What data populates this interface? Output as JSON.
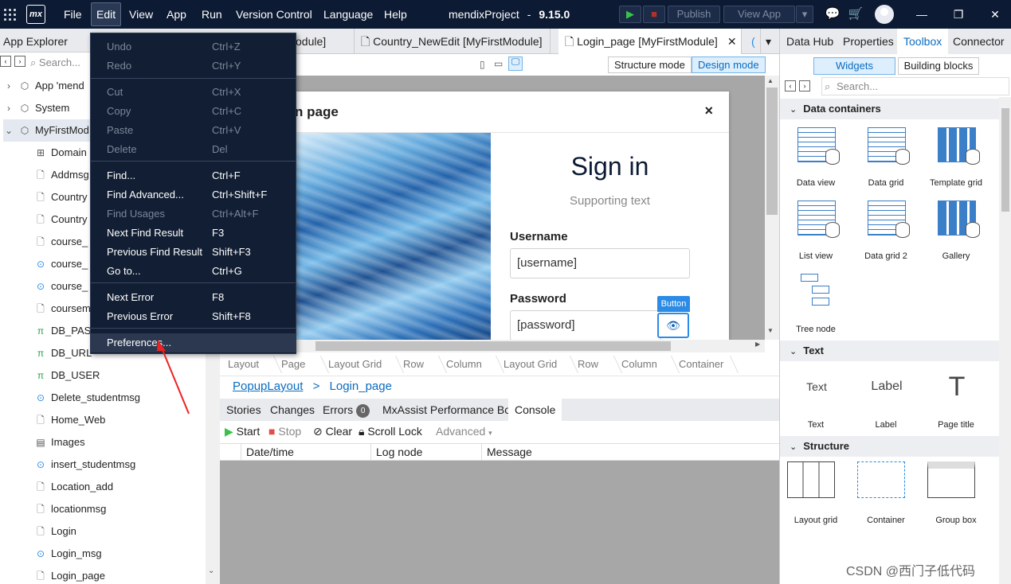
{
  "titlebar": {
    "logo": "mx",
    "menus": [
      "File",
      "Edit",
      "View",
      "App",
      "Run",
      "Version Control",
      "Language",
      "Help"
    ],
    "project": "mendixProject",
    "separator": "-",
    "version": "9.15.0",
    "publish": "Publish",
    "view_app": "View App"
  },
  "app_explorer": {
    "title": "App Explorer",
    "search_placeholder": "Search...",
    "items": [
      {
        "label": "App 'mend",
        "icon": "cube-icon"
      },
      {
        "label": "System",
        "icon": "cube-icon"
      },
      {
        "label": "MyFirstMod",
        "icon": "cube-icon"
      },
      {
        "label": "Domain",
        "icon": "domain-model-icon"
      },
      {
        "label": "Addmsg",
        "icon": "page-icon"
      },
      {
        "label": "Country",
        "icon": "page-icon"
      },
      {
        "label": "Country",
        "icon": "page-icon"
      },
      {
        "label": "course_",
        "icon": "page-icon"
      },
      {
        "label": "course_",
        "icon": "microflow-icon"
      },
      {
        "label": "course_",
        "icon": "microflow-icon"
      },
      {
        "label": "coursem",
        "icon": "page-icon"
      },
      {
        "label": "DB_PAS",
        "icon": "constant-icon"
      },
      {
        "label": "DB_URL",
        "icon": "constant-icon"
      },
      {
        "label": "DB_USER",
        "icon": "constant-icon"
      },
      {
        "label": "Delete_studentmsg",
        "icon": "microflow-icon"
      },
      {
        "label": "Home_Web",
        "icon": "page-icon"
      },
      {
        "label": "Images",
        "icon": "images-icon"
      },
      {
        "label": "insert_studentmsg",
        "icon": "microflow-icon"
      },
      {
        "label": "Location_add",
        "icon": "page-icon"
      },
      {
        "label": "locationmsg",
        "icon": "page-icon"
      },
      {
        "label": "Login",
        "icon": "page-icon"
      },
      {
        "label": "Login_msg",
        "icon": "microflow-icon"
      },
      {
        "label": "Login_page",
        "icon": "page-icon"
      }
    ]
  },
  "edit_menu": {
    "items": [
      {
        "label": "Undo",
        "shortcut": "Ctrl+Z",
        "disabled": true
      },
      {
        "label": "Redo",
        "shortcut": "Ctrl+Y",
        "disabled": true
      },
      {
        "label": "Cut",
        "shortcut": "Ctrl+X",
        "disabled": true
      },
      {
        "label": "Copy",
        "shortcut": "Ctrl+C",
        "disabled": true
      },
      {
        "label": "Paste",
        "shortcut": "Ctrl+V",
        "disabled": true
      },
      {
        "label": "Delete",
        "shortcut": "Del",
        "disabled": true
      },
      {
        "label": "Find...",
        "shortcut": "Ctrl+F",
        "disabled": false
      },
      {
        "label": "Find Advanced...",
        "shortcut": "Ctrl+Shift+F",
        "disabled": false
      },
      {
        "label": "Find Usages",
        "shortcut": "Ctrl+Alt+F",
        "disabled": true
      },
      {
        "label": "Next Find Result",
        "shortcut": "F3",
        "disabled": false
      },
      {
        "label": "Previous Find Result",
        "shortcut": "Shift+F3",
        "disabled": false
      },
      {
        "label": "Go to...",
        "shortcut": "Ctrl+G",
        "disabled": false
      },
      {
        "label": "Next Error",
        "shortcut": "F8",
        "disabled": false
      },
      {
        "label": "Previous Error",
        "shortcut": "Shift+F8",
        "disabled": false
      },
      {
        "label": "Preferences...",
        "shortcut": "",
        "disabled": false
      }
    ]
  },
  "tabs": [
    "odule]",
    "Country_NewEdit [MyFirstModule]",
    "Login_page [MyFirstModule]"
  ],
  "modes": {
    "structure": "Structure mode",
    "design": "Design mode"
  },
  "popup": {
    "title": "n page",
    "close": "×",
    "heading": "Sign in",
    "supporting": "Supporting text",
    "username_label": "Username",
    "username_value": "[username]",
    "password_label": "Password",
    "password_value": "[password]",
    "button_tag": "Button"
  },
  "breadcrumb": [
    "Layout",
    "Page",
    "Layout Grid",
    "Row",
    "Column",
    "Layout Grid",
    "Row",
    "Column",
    "Container"
  ],
  "page_path": {
    "layout": "PopupLayout",
    "sep": ">",
    "page": "Login_page"
  },
  "console": {
    "tabs": [
      "Stories",
      "Changes",
      "Errors",
      "MxAssist Performance Bot",
      "Console"
    ],
    "errors_count": "0",
    "toolbar": {
      "start": "Start",
      "stop": "Stop",
      "clear": "Clear",
      "scroll_lock": "Scroll Lock",
      "advanced": "Advanced"
    },
    "columns": [
      "Date/time",
      "Log node",
      "Message"
    ]
  },
  "right_panel": {
    "tabs": [
      "Data Hub",
      "Properties",
      "Toolbox",
      "Connector"
    ],
    "sub_tabs": [
      "Widgets",
      "Building blocks"
    ],
    "search_placeholder": "Search...",
    "sections": [
      {
        "title": "Data containers",
        "widgets": [
          "Data view",
          "Data grid",
          "Template grid",
          "List view",
          "Data grid 2",
          "Gallery",
          "Tree node"
        ]
      },
      {
        "title": "Text",
        "widgets": [
          "Text",
          "Label",
          "Page title"
        ]
      },
      {
        "title": "Structure",
        "widgets": [
          "Layout grid",
          "Container",
          "Group box"
        ]
      }
    ],
    "text_icons": {
      "text": "Text",
      "label": "Label",
      "page_title": "T"
    }
  },
  "watermark": "CSDN @西门子低代码"
}
